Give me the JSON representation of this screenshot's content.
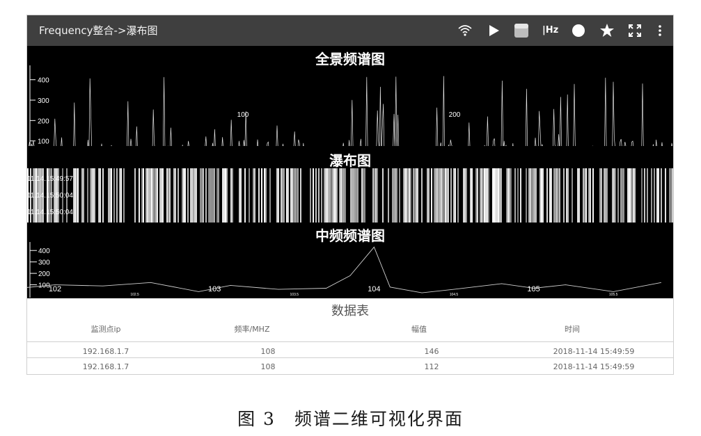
{
  "app": {
    "title": "Frequency整合->瀑布图"
  },
  "toolbar": {
    "icons": [
      "wifi-icon",
      "play-icon",
      "square-icon",
      "hz-icon",
      "record-icon",
      "star-icon",
      "fullscreen-icon",
      "more-icon"
    ],
    "hz_label": "|Hz"
  },
  "colors": {
    "toolbar_bg": "#3f3f3f",
    "panel_bg": "#000000",
    "trace": "#ffffff",
    "table_line": "#cfcfcf"
  },
  "panels": {
    "overview": {
      "title": "全景频谱图"
    },
    "waterfall": {
      "title": "瀑布图",
      "timestamps": [
        "11.14.15:49:57",
        "11.14.15:50:04",
        "11.14.15:50:04"
      ]
    },
    "if_spectrum": {
      "title": "中频频谱图"
    }
  },
  "chart_data": [
    {
      "type": "line",
      "title": "全景频谱图",
      "y_ticks": [
        100,
        200,
        300,
        400
      ],
      "x_tick_labels": [
        "100",
        "200"
      ],
      "ylim": [
        0,
        450
      ],
      "series": [
        {
          "style": "dense white spikes",
          "peak_values_approx": [
            380,
            420,
            350,
            440,
            300,
            400,
            360,
            410
          ]
        }
      ],
      "grid": false
    },
    {
      "type": "heatmap",
      "title": "瀑布图",
      "y_tick_labels": [
        "11.14.15:49:57",
        "11.14.15:50:04",
        "11.14.15:50:04"
      ]
    },
    {
      "type": "line",
      "title": "中频频谱图",
      "y_ticks": [
        100,
        200,
        300,
        400
      ],
      "x_tick_labels": [
        "102",
        "103",
        "104",
        "105"
      ],
      "x_minor_labels": [
        "102.5",
        "103.5",
        "104.5",
        "105.5"
      ],
      "ylim": [
        0,
        450
      ],
      "x": [
        101.7,
        102.0,
        102.3,
        102.6,
        102.9,
        103.1,
        103.4,
        103.7,
        103.85,
        104.0,
        104.1,
        104.3,
        104.5,
        104.8,
        105.0,
        105.2,
        105.5,
        105.8
      ],
      "y": [
        60,
        100,
        90,
        120,
        40,
        95,
        60,
        70,
        180,
        430,
        80,
        30,
        60,
        110,
        70,
        100,
        40,
        120
      ]
    }
  ],
  "table": {
    "title": "数据表",
    "headers": [
      "监测点ip",
      "频率/MHZ",
      "幅值",
      "时间"
    ],
    "rows": [
      [
        "192.168.1.7",
        "108",
        "146",
        "2018-11-14 15:49:59"
      ],
      [
        "192.168.1.7",
        "108",
        "112",
        "2018-11-14 15:49:59"
      ]
    ]
  },
  "caption": "图 3　频谱二维可视化界面"
}
